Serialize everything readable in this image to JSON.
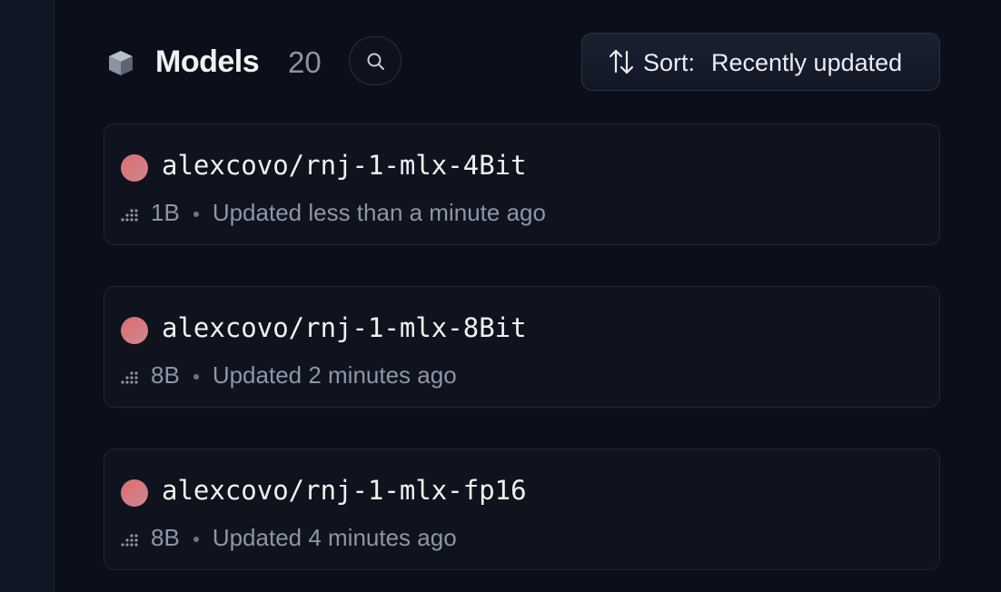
{
  "header": {
    "title": "Models",
    "count": "20",
    "search_icon": "search-icon",
    "sort": {
      "label": "Sort:",
      "value": "Recently updated",
      "icon": "sort-arrows-icon"
    }
  },
  "models": [
    {
      "name": "alexcovo/rnj-1-mlx-4Bit",
      "params": "1B",
      "updated": "Updated less than a minute ago"
    },
    {
      "name": "alexcovo/rnj-1-mlx-8Bit",
      "params": "8B",
      "updated": "Updated 2 minutes ago"
    },
    {
      "name": "alexcovo/rnj-1-mlx-fp16",
      "params": "8B",
      "updated": "Updated 4 minutes ago"
    }
  ]
}
